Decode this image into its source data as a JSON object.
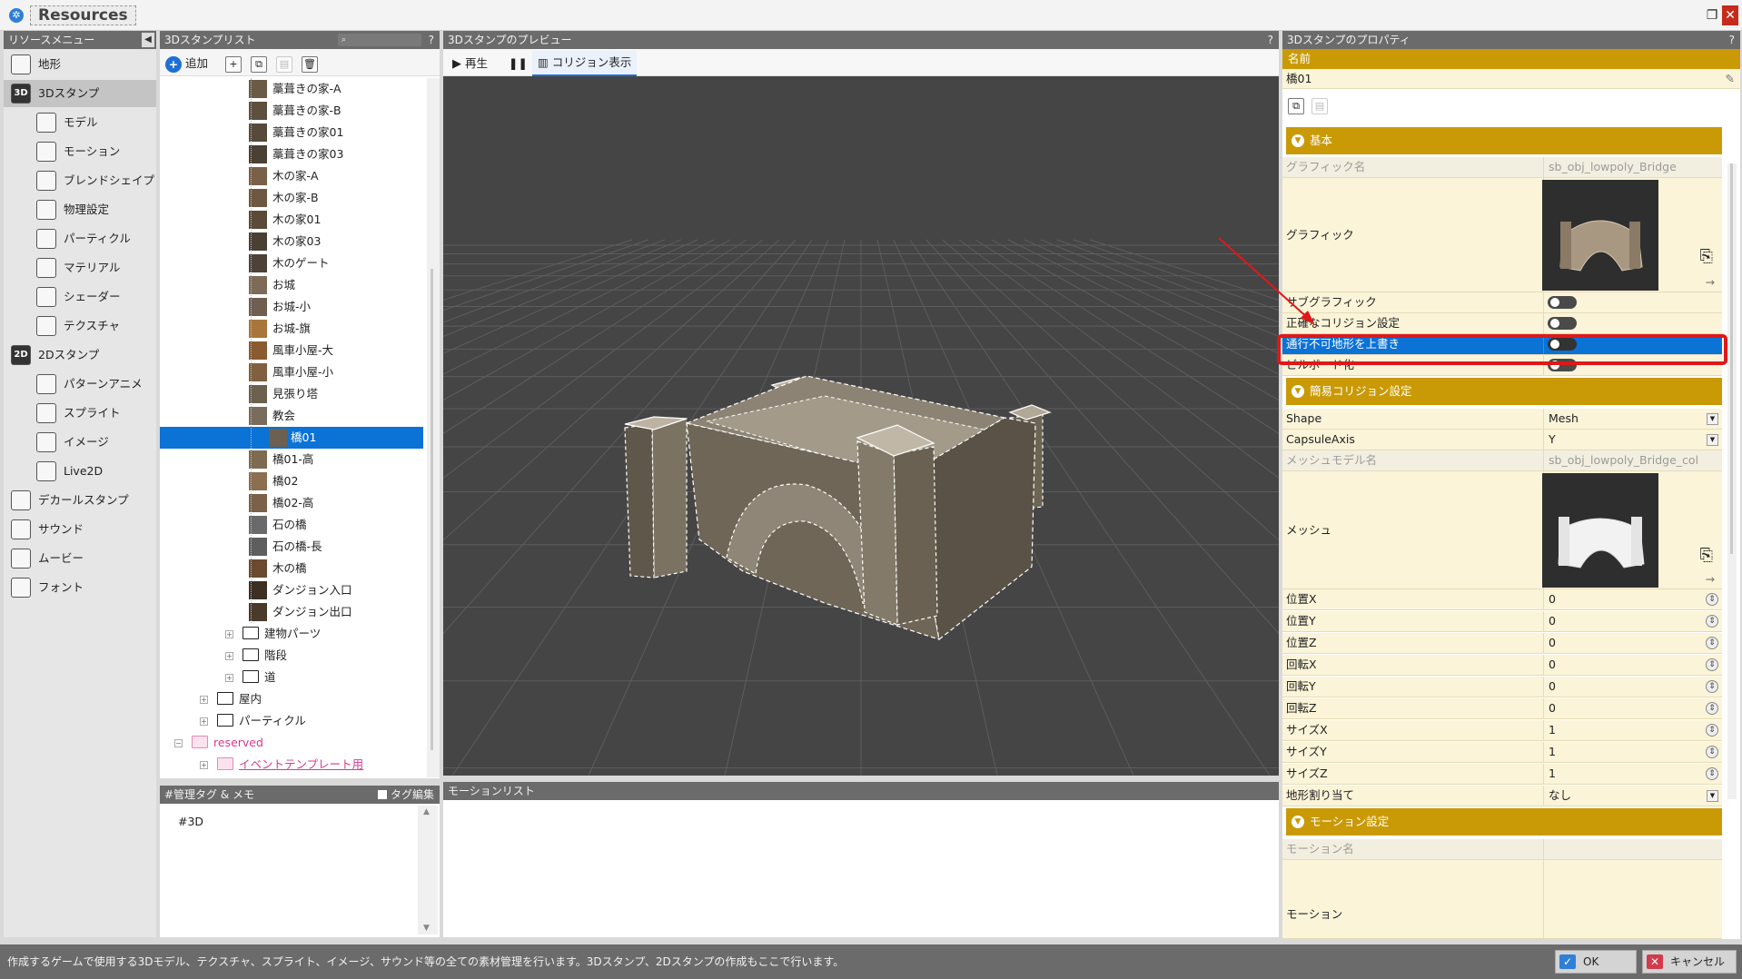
{
  "window": {
    "title": "Resources"
  },
  "left_menu": {
    "title": "リソースメニュー",
    "items": [
      {
        "label": "地形",
        "icon": "terrain-icon"
      },
      {
        "label": "3Dスタンプ",
        "icon": "3d-icon",
        "badge": "3D",
        "selected": true
      },
      {
        "label": "モデル",
        "icon": "model-icon"
      },
      {
        "label": "モーション",
        "icon": "motion-icon"
      },
      {
        "label": "ブレンドシェイプ",
        "icon": "blendshape-icon"
      },
      {
        "label": "物理設定",
        "icon": "physics-icon"
      },
      {
        "label": "パーティクル",
        "icon": "particle-icon"
      },
      {
        "label": "マテリアル",
        "icon": "material-icon"
      },
      {
        "label": "シェーダー",
        "icon": "shader-icon"
      },
      {
        "label": "テクスチャ",
        "icon": "texture-icon"
      },
      {
        "label": "2Dスタンプ",
        "icon": "2d-icon",
        "badge": "2D"
      },
      {
        "label": "パターンアニメ",
        "icon": "pattern-anime-icon"
      },
      {
        "label": "スプライト",
        "icon": "sprite-icon"
      },
      {
        "label": "イメージ",
        "icon": "image-icon"
      },
      {
        "label": "Live2D",
        "icon": "live2d-icon"
      },
      {
        "label": "デカールスタンプ",
        "icon": "decal-icon"
      },
      {
        "label": "サウンド",
        "icon": "sound-icon"
      },
      {
        "label": "ムービー",
        "icon": "movie-icon"
      },
      {
        "label": "フォント",
        "icon": "font-icon"
      }
    ]
  },
  "stamp_list": {
    "title": "3Dスタンプリスト",
    "add_label": "追加",
    "items": [
      {
        "label": "藁葺きの家-A"
      },
      {
        "label": "藁葺きの家-B"
      },
      {
        "label": "藁葺きの家01"
      },
      {
        "label": "藁葺きの家03"
      },
      {
        "label": "木の家-A"
      },
      {
        "label": "木の家-B"
      },
      {
        "label": "木の家01"
      },
      {
        "label": "木の家03"
      },
      {
        "label": "木のゲート"
      },
      {
        "label": "お城"
      },
      {
        "label": "お城-小"
      },
      {
        "label": "お城-旗"
      },
      {
        "label": "風車小屋-大"
      },
      {
        "label": "風車小屋-小"
      },
      {
        "label": "見張り塔"
      },
      {
        "label": "教会"
      },
      {
        "label": "橋01",
        "selected": true
      },
      {
        "label": "橋01-高"
      },
      {
        "label": "橋02"
      },
      {
        "label": "橋02-高"
      },
      {
        "label": "石の橋"
      },
      {
        "label": "石の橋-長"
      },
      {
        "label": "木の橋"
      },
      {
        "label": "ダンジョン入口"
      },
      {
        "label": "ダンジョン出口"
      }
    ],
    "folders": [
      {
        "label": "建物パーツ",
        "level": 2
      },
      {
        "label": "階段",
        "level": 2
      },
      {
        "label": "道",
        "level": 2
      },
      {
        "label": "屋内",
        "level": 1
      },
      {
        "label": "パーティクル",
        "level": 1
      }
    ],
    "reserved": {
      "label": "reserved",
      "child": "イベントテンプレート用"
    }
  },
  "tag_panel": {
    "title": "#管理タグ & メモ",
    "edit_label": "タグ編集",
    "content": "#3D"
  },
  "preview": {
    "title": "3Dスタンプのプレビュー",
    "play_label": "再生",
    "collision_label": "コリジョン表示"
  },
  "motion_list": {
    "title": "モーションリスト"
  },
  "properties": {
    "title": "3Dスタンプのプロパティ",
    "name_label": "名前",
    "name_value": "橋01",
    "basic": {
      "section": "基本",
      "graphic_name_label": "グラフィック名",
      "graphic_name_value": "sb_obj_lowpoly_Bridge",
      "graphic_label": "グラフィック",
      "subgraphic_label": "サブグラフィック",
      "collision_label": "正確なコリジョン設定",
      "override_label": "通行不可地形を上書き",
      "billboard_label": "ビルボード化"
    },
    "simple_collision": {
      "section": "簡易コリジョン設定",
      "shape_label": "Shape",
      "shape_value": "Mesh",
      "capsule_label": "CapsuleAxis",
      "capsule_value": "Y",
      "mesh_model_label": "メッシュモデル名",
      "mesh_model_value": "sb_obj_lowpoly_Bridge_col",
      "mesh_label": "メッシュ"
    },
    "transform": [
      {
        "label": "位置X",
        "value": "0"
      },
      {
        "label": "位置Y",
        "value": "0"
      },
      {
        "label": "位置Z",
        "value": "0"
      },
      {
        "label": "回転X",
        "value": "0"
      },
      {
        "label": "回転Y",
        "value": "0"
      },
      {
        "label": "回転Z",
        "value": "0"
      },
      {
        "label": "サイズX",
        "value": "1"
      },
      {
        "label": "サイズY",
        "value": "1"
      },
      {
        "label": "サイズZ",
        "value": "1"
      }
    ],
    "terrain_label": "地形割り当て",
    "terrain_value": "なし",
    "motion": {
      "section": "モーション設定",
      "motion_name_label": "モーション名",
      "motion_label": "モーション"
    }
  },
  "status": {
    "text": "作成するゲームで使用する3Dモデル、テクスチャ、スプライト、イメージ、サウンド等の全ての素材管理を行います。3Dスタンプ、2Dスタンプの作成もここで行います。",
    "ok_label": "OK",
    "cancel_label": "キャンセル"
  },
  "colors": {
    "accent_gold": "#c99a06",
    "selection_blue": "#0b72d6",
    "highlight_red": "#e01818",
    "viewport": "#454545"
  }
}
